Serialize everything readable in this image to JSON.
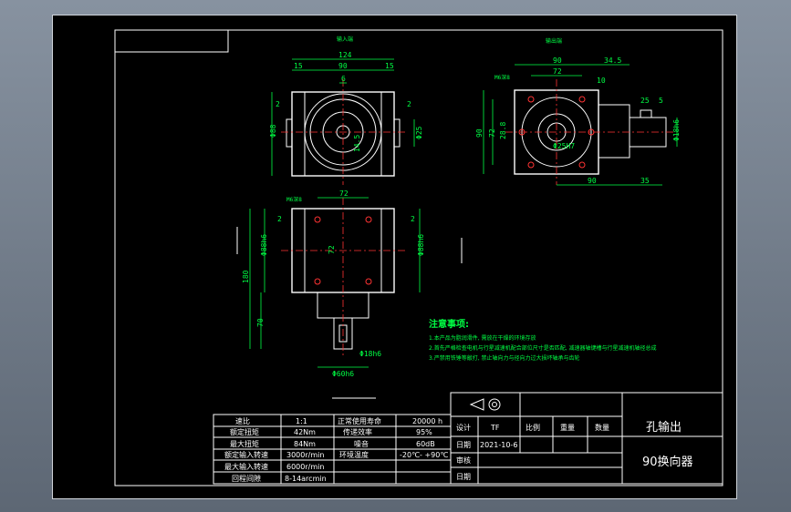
{
  "views": {
    "input_view_label": "输入端",
    "output_view_label": "输出端"
  },
  "front_dims": {
    "overall": "124",
    "left_flange": "15",
    "body": "90",
    "right_flange": "15",
    "key": "6",
    "gap_left": "2",
    "gap_right": "2",
    "height_left": "Φ88",
    "shaft_dia": "Φ25",
    "key_depth": "14.5"
  },
  "side_dims": {
    "right_total": "90",
    "offset": "34.5",
    "thread_label": "M6深8",
    "bolt_pitch": "72",
    "edge": "10",
    "height": "90",
    "inner": "72",
    "center": "28.8",
    "shaft_len": "25",
    "shaft_small": "5",
    "bore": "Φ25H7",
    "shaft_dia": "Φ18h6",
    "base_len": "90",
    "tail": "35"
  },
  "bottom_dims": {
    "thread_label": "M6深8",
    "width": "72",
    "gap_left": "2",
    "gap_right": "2",
    "inner": "72",
    "left_dia": "Φ88h6",
    "right_dia": "Φ88h6",
    "overall_height": "180",
    "lower_height": "70",
    "shaft_dia": "Φ18h6",
    "base_dia": "Φ60h6"
  },
  "notes": {
    "title": "注意事项:",
    "items": [
      "1.本产品为脂润滑件, 需放在干燥的环境存放",
      "2.首先严格检查电机与行星减速机配合部位尺寸是否匹配, 减速器轴键槽与行星减速机轴径总成",
      "3.严禁用铁锤等敲打, 禁止轴向力与径向力过大损坏轴承与齿轮"
    ]
  },
  "spec_table": {
    "rows": [
      {
        "k1": "速比",
        "v1": "1:1",
        "k2": "正常使用寿命",
        "v2": "20000 h"
      },
      {
        "k1": "额定扭矩",
        "v1": "42Nm",
        "k2": "传递效率",
        "v2": "95%"
      },
      {
        "k1": "最大扭矩",
        "v1": "84Nm",
        "k2": "噪音",
        "v2": "60dB"
      },
      {
        "k1": "额定输入转速",
        "v1": "3000r/min",
        "k2": "环境温度",
        "v2": "-20℃- +90℃"
      },
      {
        "k1": "最大输入转速",
        "v1": "6000r/min",
        "k2": "",
        "v2": ""
      },
      {
        "k1": "回程间隙",
        "v1": "8-14arcmin",
        "k2": "",
        "v2": ""
      }
    ]
  },
  "title_block": {
    "design_label": "设计",
    "designer": "TF",
    "scale_label": "比例",
    "weight_label": "重量",
    "quantity_label": "数量",
    "date_label": "日期",
    "date_value": "2021-10-6",
    "review_label": "审核",
    "date_label2": "日期",
    "title_line1": "孔输出",
    "title_line2": "90换向器"
  },
  "colors": {
    "background": "#000000",
    "geometry": "#ffffff",
    "dimension": "#00ff44",
    "centerline": "#ff3333"
  }
}
